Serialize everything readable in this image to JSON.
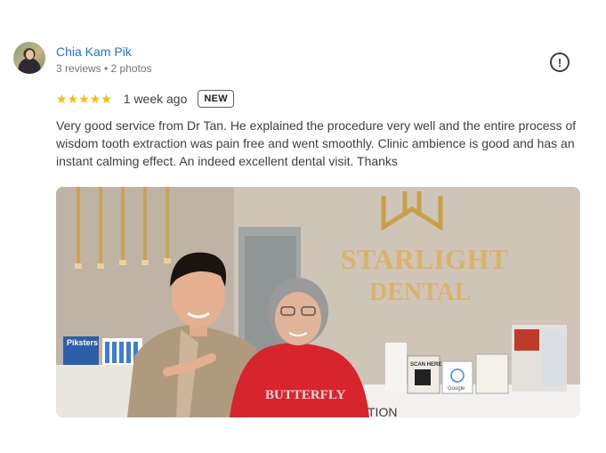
{
  "review": {
    "author": "Chia Kam Pik",
    "meta": "3 reviews • 2 photos",
    "stars": "★★★★★",
    "rating": 5,
    "time": "1 week ago",
    "badge": "NEW",
    "text": "Very good service from Dr Tan. He explained the procedure very well and the entire process of wisdom tooth extraction was pain free and went smoothly. Clinic ambience is good and has an instant calming effect. An indeed excellent dental visit. Thanks",
    "photo": {
      "sign_line1": "STARLIGHT",
      "sign_line2": "DENTAL",
      "shirt_text": "BUTTERFLY",
      "counter_text": "TION",
      "product_label": "Piksters",
      "scan_card": "SCAN HERE",
      "google_card": "Google"
    }
  },
  "colors": {
    "link": "#1a73e8",
    "star": "#fbbc04",
    "text": "#3c4043"
  }
}
